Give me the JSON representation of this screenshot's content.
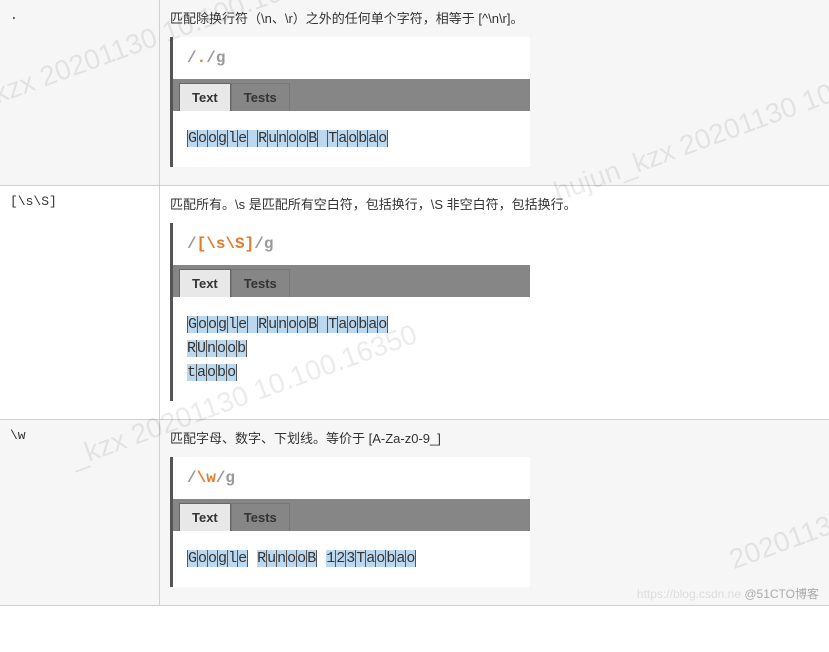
{
  "watermarks": [
    "_kzx 20201130 10.100.16",
    "hujun_kzx 20201130 10.10",
    "_kzx 20201130 10.100.16350",
    "20201130"
  ],
  "credit_faint": "https://blog.csdn.ne",
  "credit": "@51CTO博客",
  "tabs": {
    "text": "Text",
    "tests": "Tests"
  },
  "rows": [
    {
      "pattern": ".",
      "desc": "匹配除换行符（\\n、\\r）之外的任何单个字符，相等于 [^\\n\\r]。",
      "rx_pre": "/",
      "rx_pat": ".",
      "rx_post": "/g",
      "match_html": "<span class='hl'>G</span><span class='hl'>o</span><span class='hl'>o</span><span class='hl'>g</span><span class='hl'>l</span><span class='hl'>e</span><span class='hl'>&nbsp;</span><span class='hl'>R</span><span class='hl'>u</span><span class='hl'>n</span><span class='hl'>o</span><span class='hl'>o</span><span class='hl'>B</span><span class='hl'>&nbsp;</span><span class='hl'>T</span><span class='hl'>a</span><span class='hl'>o</span><span class='hl'>b</span><span class='hl'>a</span><span class='hl'>o</span>"
    },
    {
      "pattern": "[\\s\\S]",
      "desc": "匹配所有。\\s 是匹配所有空白符，包括换行，\\S 非空白符，包括换行。",
      "rx_pre": "/",
      "rx_pat": "[\\s\\S]",
      "rx_post": "/g",
      "match_html": "<span class='hl'>G</span><span class='hl'>o</span><span class='hl'>o</span><span class='hl'>g</span><span class='hl'>l</span><span class='hl'>e</span><span class='hl'>&nbsp;</span><span class='hl'>R</span><span class='hl'>u</span><span class='hl'>n</span><span class='hl'>o</span><span class='hl'>o</span><span class='hl'>B</span><span class='hl'>&nbsp;</span><span class='hl'>T</span><span class='hl'>a</span><span class='hl'>o</span><span class='hl'>b</span><span class='hl'>a</span><span class='hl'>o</span><br><span class='hl'>R</span><span class='hl'>U</span><span class='hl'>n</span><span class='hl'>o</span><span class='hl'>o</span><span class='hl'>b</span><br><span class='hl'>t</span><span class='hl'>a</span><span class='hl'>o</span><span class='hl'>b</span><span class='hl'>o</span>"
    },
    {
      "pattern": "\\w",
      "desc": "匹配字母、数字、下划线。等价于 [A-Za-z0-9_]",
      "rx_pre": "/",
      "rx_pat": "\\w",
      "rx_post": "/g",
      "match_html": "<span class='hl'>G</span><span class='hl'>o</span><span class='hl'>o</span><span class='hl'>g</span><span class='hl'>l</span><span class='hl'>e</span> <span class='hl'>R</span><span class='hl'>u</span><span class='hl'>n</span><span class='hl'>o</span><span class='hl'>o</span><span class='hl'>B</span> <span class='hl'>1</span><span class='hl'>2</span><span class='hl'>3</span><span class='hl'>T</span><span class='hl'>a</span><span class='hl'>o</span><span class='hl'>b</span><span class='hl'>a</span><span class='hl'>o</span>"
    }
  ]
}
